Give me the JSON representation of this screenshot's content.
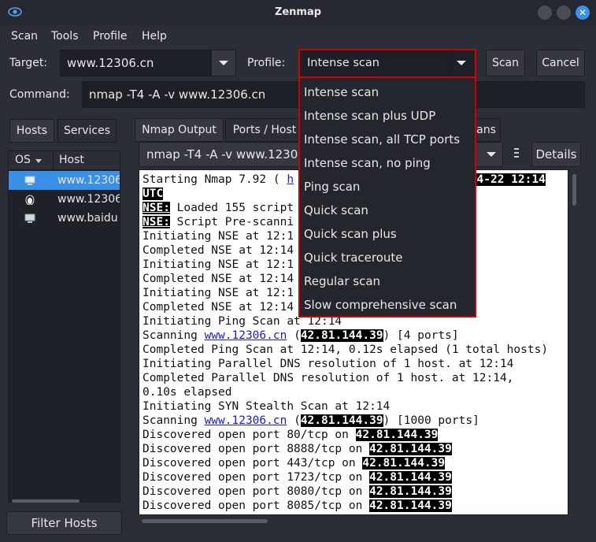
{
  "window": {
    "title": "Zenmap"
  },
  "menu": [
    "Scan",
    "Tools",
    "Profile",
    "Help"
  ],
  "toolbar": {
    "target_label": "Target:",
    "target_value": "www.12306.cn",
    "profile_label": "Profile:",
    "profile_value": "Intense scan",
    "scan_button": "Scan",
    "cancel_button": "Cancel",
    "command_label": "Command:",
    "command_value": "nmap -T4 -A -v www.12306.cn"
  },
  "left_panel": {
    "tabs": [
      "Hosts",
      "Services"
    ],
    "columns": [
      "OS",
      "Host"
    ],
    "hosts": [
      {
        "name": "www.12306",
        "os_icon": "windows-computer-icon",
        "selected": true
      },
      {
        "name": "www.12306",
        "os_icon": "linux-penguin-icon",
        "selected": false
      },
      {
        "name": "www.baidu",
        "os_icon": "unknown-os-icon",
        "selected": false
      }
    ],
    "filter_button": "Filter Hosts"
  },
  "right_panel": {
    "tabs": [
      "Nmap Output",
      "Ports / Host",
      "ans"
    ],
    "command_select_value": "nmap -T4 -A -v www.12306",
    "details_button": "Details"
  },
  "output_lines": [
    {
      "parts": [
        "Starting Nmap 7.92 ( ",
        "h",
        "",
        "-04-22 12:14"
      ]
    },
    {
      "text": "UTC"
    },
    {
      "nse": "NSE:",
      "text": " Loaded 155 script"
    },
    {
      "nse": "NSE:",
      "text": " Script Pre-scanni"
    },
    {
      "text": "Initiating NSE at 12:1"
    },
    {
      "text": "Completed NSE at 12:14"
    },
    {
      "text": "Initiating NSE at 12:1"
    },
    {
      "text": "Completed NSE at 12:14"
    },
    {
      "text": "Initiating NSE at 12:1"
    },
    {
      "text": "Completed NSE at 12:14"
    },
    {
      "text": "Initiating Ping Scan at 12:14"
    },
    {
      "pre": "Scanning ",
      "link": "www.12306.cn",
      "mid": " (",
      "ip": "42.81.144.39",
      "post": ") [4 ports]"
    },
    {
      "text": "Completed Ping Scan at 12:14, 0.12s elapsed (1 total hosts)"
    },
    {
      "text": "Initiating Parallel DNS resolution of 1 host. at 12:14"
    },
    {
      "text": "Completed Parallel DNS resolution of 1 host. at 12:14,"
    },
    {
      "text": "0.10s elapsed"
    },
    {
      "text": "Initiating SYN Stealth Scan at 12:14"
    },
    {
      "pre": "Scanning ",
      "link": "www.12306.cn",
      "mid": " (",
      "ip": "42.81.144.39",
      "post": ") [1000 ports]"
    },
    {
      "pre": "Discovered open port 80/tcp on ",
      "ip": "42.81.144.39"
    },
    {
      "pre": "Discovered open port 8888/tcp on ",
      "ip": "42.81.144.39"
    },
    {
      "pre": "Discovered open port 443/tcp on ",
      "ip": "42.81.144.39"
    },
    {
      "pre": "Discovered open port 1723/tcp on ",
      "ip": "42.81.144.39"
    },
    {
      "pre": "Discovered open port 8080/tcp on ",
      "ip": "42.81.144.39"
    },
    {
      "pre": "Discovered open port 8085/tcp on ",
      "ip": "42.81.144.39"
    }
  ],
  "profile_dropdown": {
    "options": [
      "Intense scan",
      "Intense scan plus UDP",
      "Intense scan, all TCP ports",
      "Intense scan, no ping",
      "Ping scan",
      "Quick scan",
      "Quick scan plus",
      "Quick traceroute",
      "Regular scan",
      "Slow comprehensive scan"
    ]
  },
  "colors": {
    "highlight_border": "#d40000",
    "selection": "#3a8fe6",
    "link": "#1a1ad8"
  }
}
